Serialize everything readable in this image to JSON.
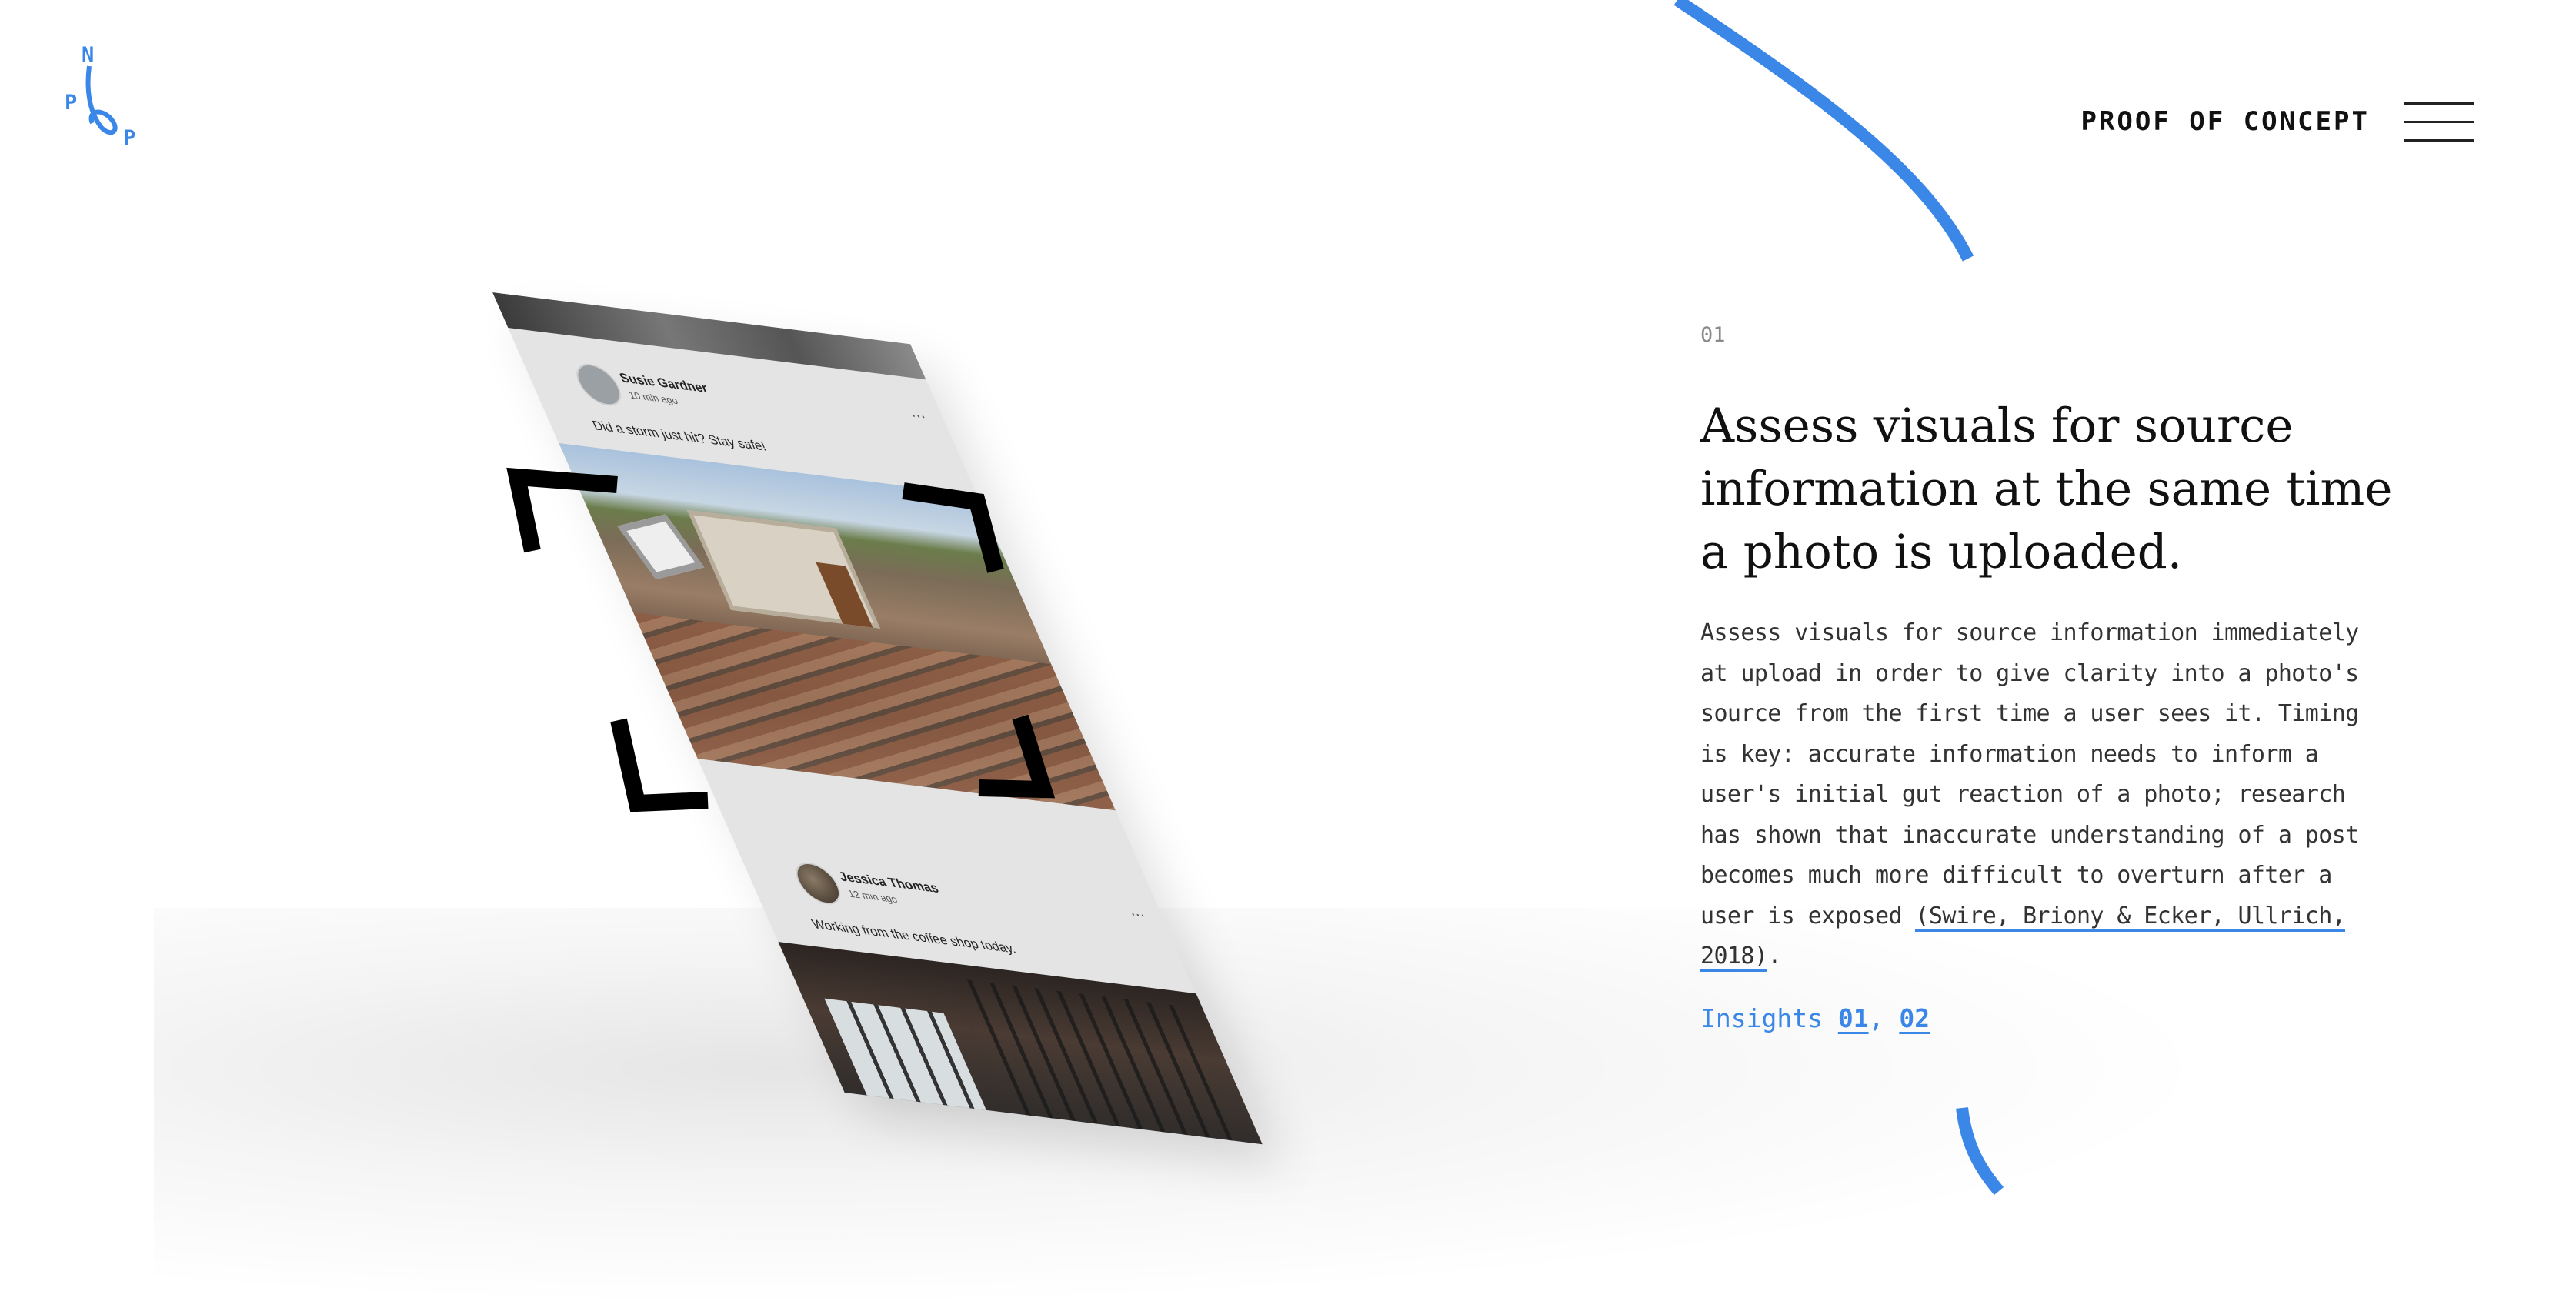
{
  "brand": {
    "logo_letters": [
      "N",
      "P",
      "P"
    ],
    "accent_color": "#3a87e8"
  },
  "header": {
    "title": "PROOF OF CONCEPT",
    "menu_icon": "hamburger-menu-icon"
  },
  "device_mockup": {
    "posts": [
      {
        "author": "Susie Gardner",
        "time": "10 min ago",
        "text": "Did a storm just hit? Stay safe!",
        "more_icon": "more-dots-icon"
      },
      {
        "author": "Jessica Thomas",
        "time": "12 min ago",
        "text": "Working from the coffee shop today.",
        "more_icon": "more-dots-icon"
      }
    ],
    "overlay_icon": "scan-frame-icon"
  },
  "content": {
    "step_number": "01",
    "headline": "Assess visuals for source information at the same time a photo is uploaded.",
    "body": "Assess visuals for source information immediately at upload in order to give clarity into a photo's source from the first time a user sees it. Timing is key: accurate information needs to inform a user's initial gut reaction of a photo; research has shown that inaccurate understanding of a post becomes much more difficult to overturn after a user is exposed",
    "citation": "(Swire, Briony & Ecker, Ullrich, 2018)",
    "body_end": ".",
    "insights_label": "Insights",
    "insight_links": [
      "01",
      "02"
    ],
    "insight_separator": ","
  }
}
